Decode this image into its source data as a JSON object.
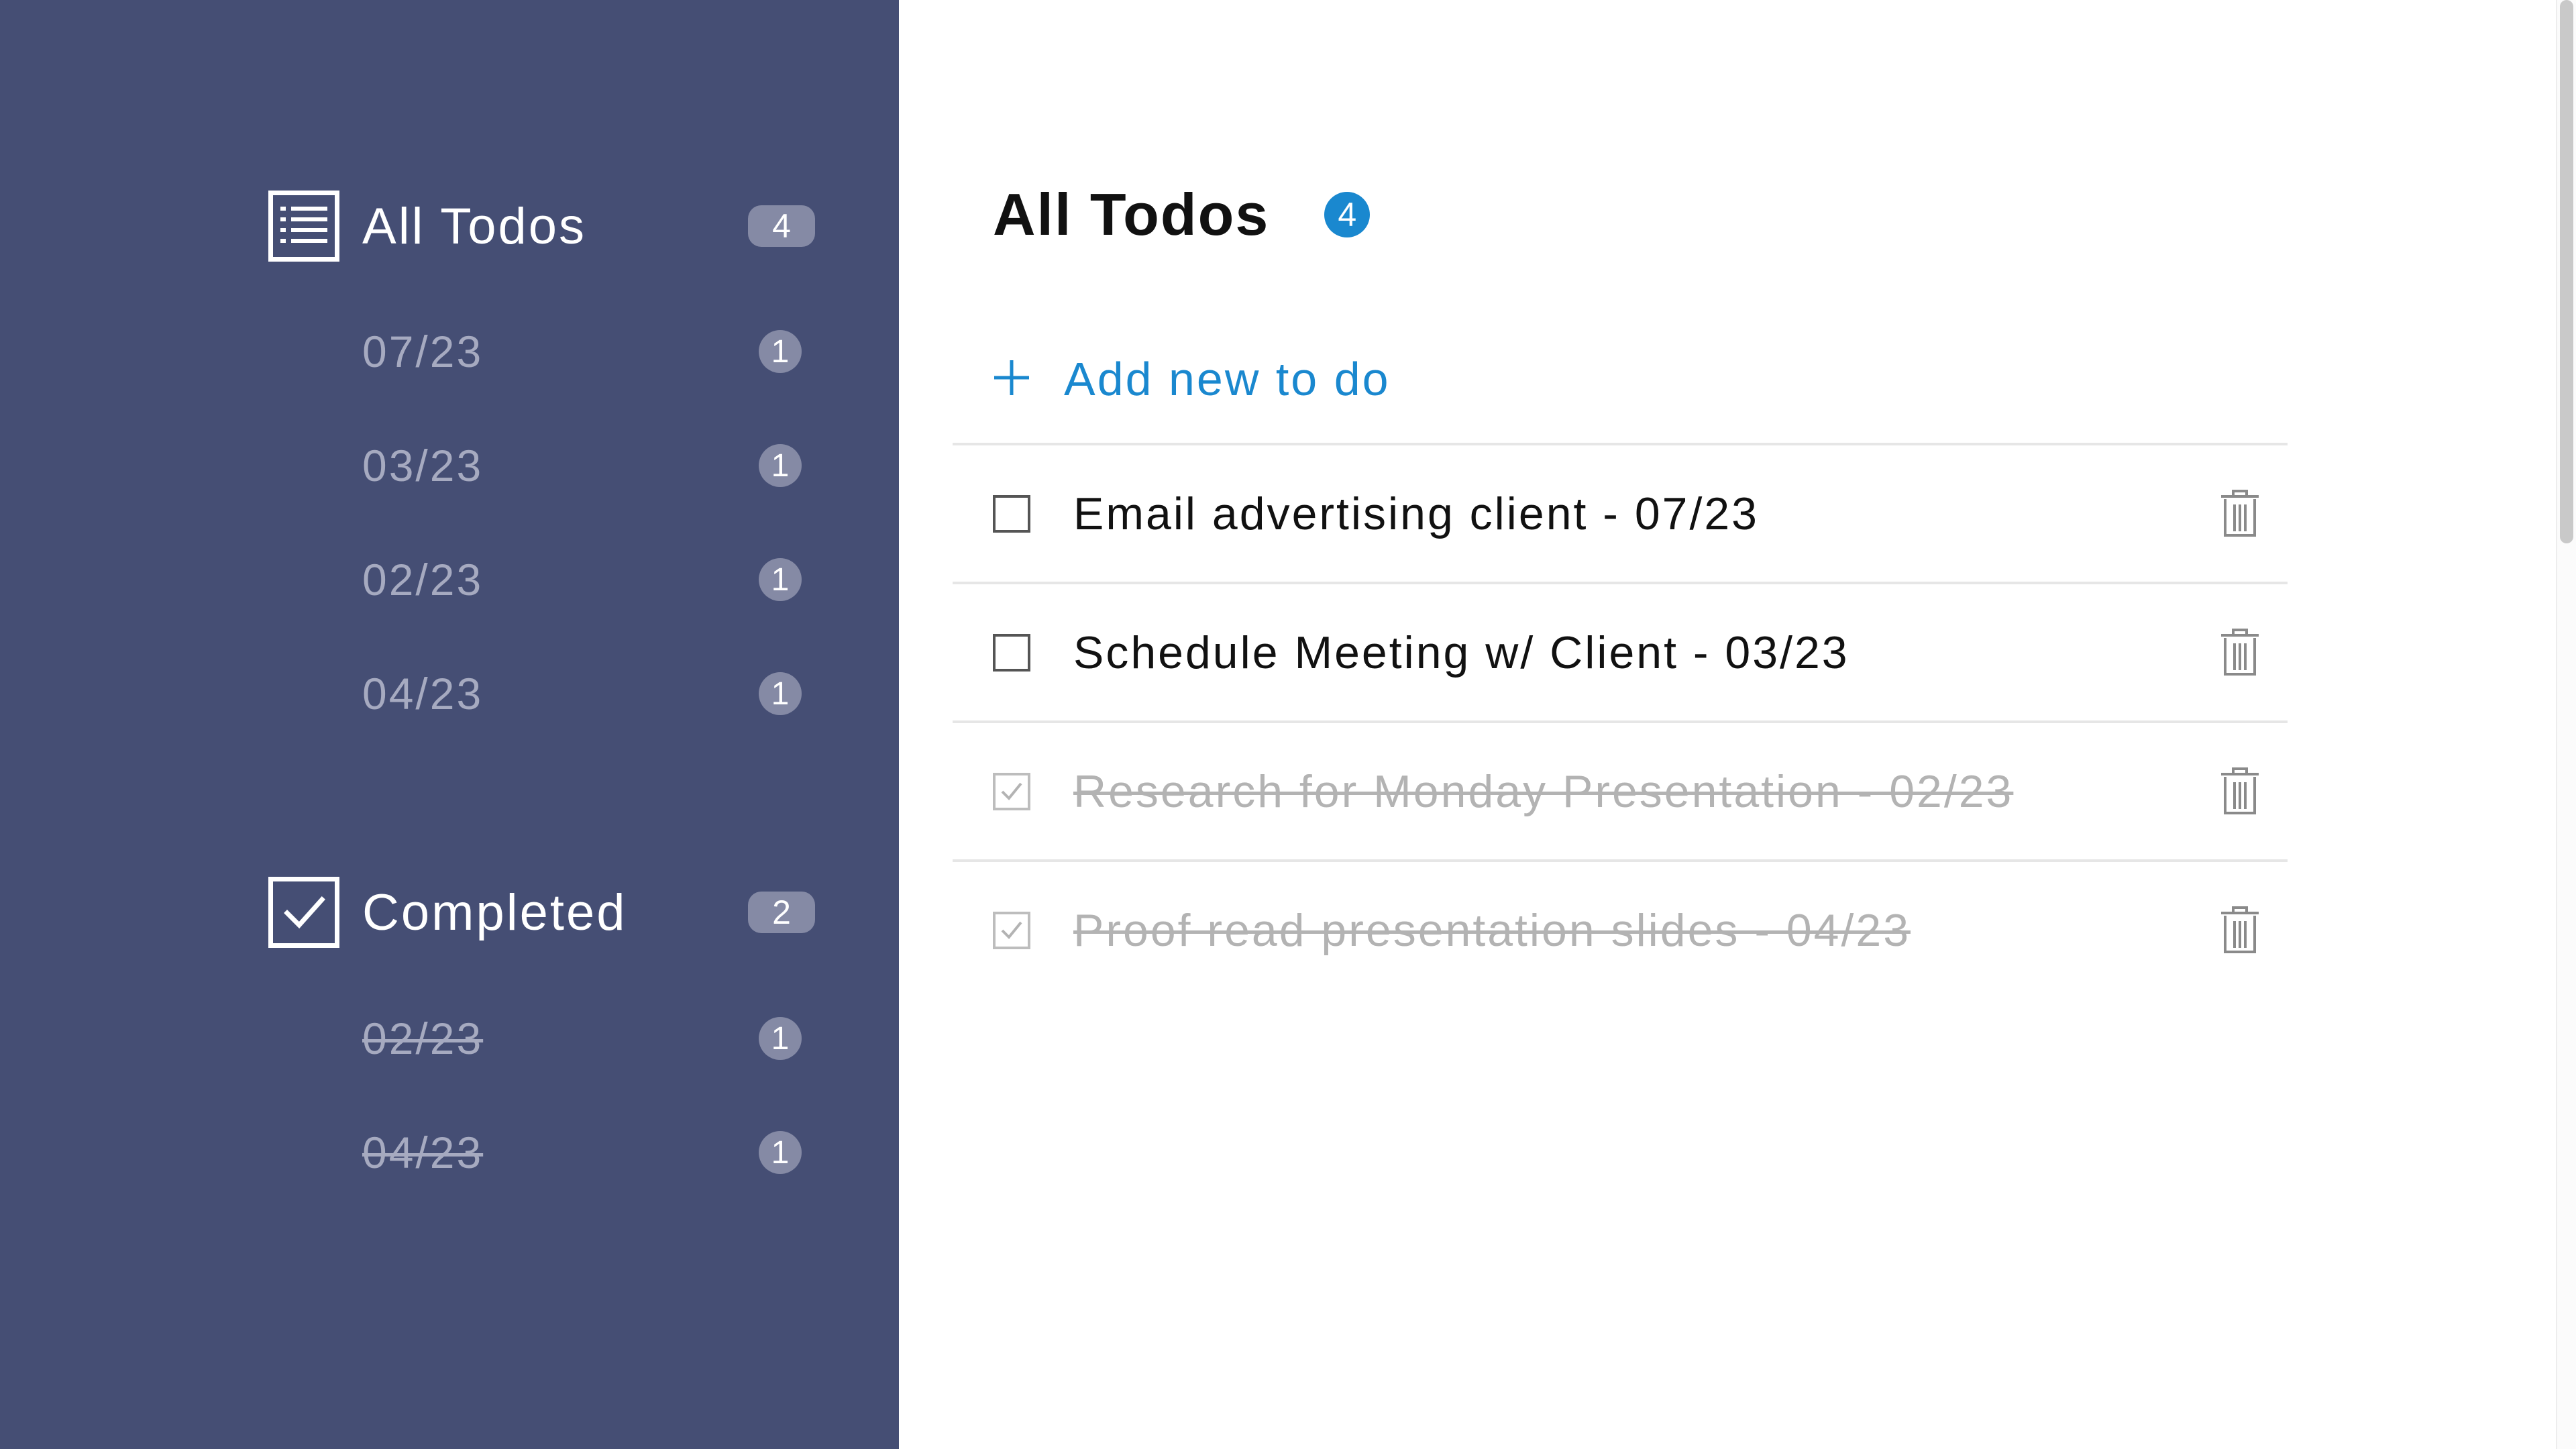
{
  "sidebar": {
    "all_todos": {
      "label": "All Todos",
      "count": "4",
      "icon": "list-icon",
      "items": [
        {
          "label": "07/23",
          "count": "1"
        },
        {
          "label": "03/23",
          "count": "1"
        },
        {
          "label": "02/23",
          "count": "1"
        },
        {
          "label": "04/23",
          "count": "1"
        }
      ]
    },
    "completed": {
      "label": "Completed",
      "count": "2",
      "icon": "checkbox-checked-icon",
      "items": [
        {
          "label": "02/23",
          "count": "1"
        },
        {
          "label": "04/23",
          "count": "1"
        }
      ]
    }
  },
  "main": {
    "title": "All Todos",
    "count": "4",
    "add_label": "Add new to do",
    "todos": [
      {
        "text": "Email advertising client - 07/23",
        "completed": false
      },
      {
        "text": "Schedule Meeting w/ Client - 03/23",
        "completed": false
      },
      {
        "text": "Research for Monday Presentation - 02/23",
        "completed": true
      },
      {
        "text": "Proof read presentation slides - 04/23",
        "completed": true
      }
    ]
  },
  "colors": {
    "sidebar_bg": "#454e74",
    "accent": "#1a88cf",
    "badge_bg": "#858aa5",
    "muted_text": "#a6aac0",
    "completed_text": "#b3b3b3"
  }
}
